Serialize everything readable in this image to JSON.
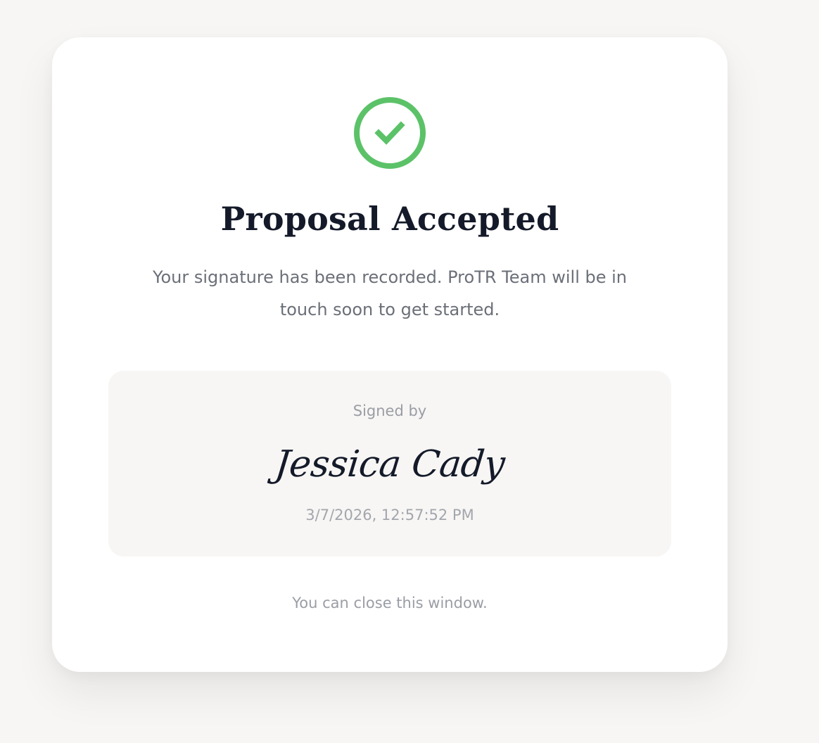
{
  "status": {
    "icon": "check-circle-icon",
    "color": "#5cc268"
  },
  "title": "Proposal Accepted",
  "message": "Your signature has been recorded. ProTR Team will be in touch soon to get started.",
  "signature_panel": {
    "label": "Signed by",
    "signer_name": "Jessica Cady",
    "signed_at": "3/7/2026, 12:57:52 PM"
  },
  "footer_note": "You can close this window.",
  "colors": {
    "background": "#f7f6f4",
    "card": "#ffffff",
    "heading": "#141a29",
    "body_text": "#6b6f78",
    "muted_text": "#9a9da4",
    "success": "#5cc268"
  }
}
